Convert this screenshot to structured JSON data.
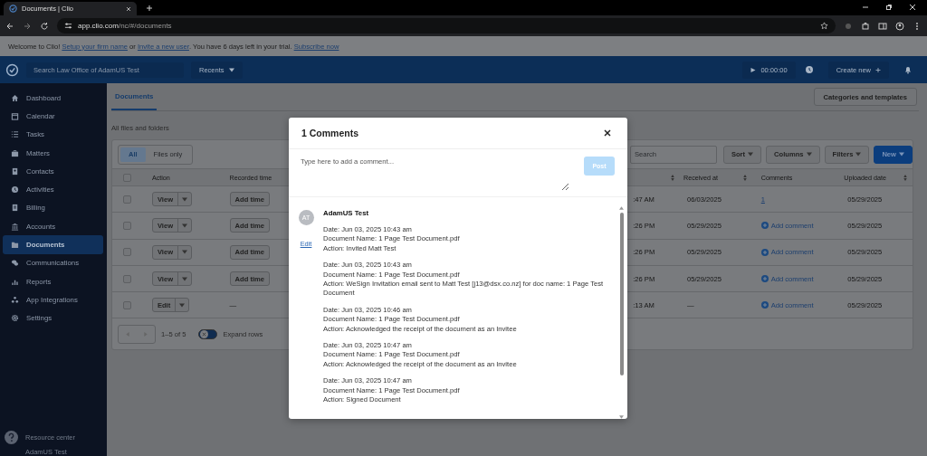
{
  "browser": {
    "tab_title": "Documents | Clio",
    "url_host": "app.clio.com",
    "url_path": "/nc/#/documents"
  },
  "banner": {
    "parts": [
      {
        "text": "Welcome to Clio! ",
        "link": false
      },
      {
        "text": "Setup your firm name",
        "link": true
      },
      {
        "text": " or ",
        "link": false
      },
      {
        "text": "Invite a new user",
        "link": true
      },
      {
        "text": ".  You have 6 days left in your trial. ",
        "link": false
      },
      {
        "text": "Subscribe now",
        "link": true
      }
    ]
  },
  "header": {
    "search_placeholder": "Search Law Office of AdamUS Test",
    "recents": "Recents",
    "timer": "00:00:00",
    "create_new": "Create new"
  },
  "sidebar": {
    "items": [
      {
        "label": "Dashboard",
        "selected": false
      },
      {
        "label": "Calendar",
        "selected": false
      },
      {
        "label": "Tasks",
        "selected": false
      },
      {
        "label": "Matters",
        "selected": false
      },
      {
        "label": "Contacts",
        "selected": false
      },
      {
        "label": "Activities",
        "selected": false
      },
      {
        "label": "Billing",
        "selected": false
      },
      {
        "label": "Accounts",
        "selected": false
      },
      {
        "label": "Documents",
        "selected": true
      },
      {
        "label": "Communications",
        "selected": false
      },
      {
        "label": "Reports",
        "selected": false
      },
      {
        "label": "App Integrations",
        "selected": false
      },
      {
        "label": "Settings",
        "selected": false
      }
    ],
    "resource_center": "Resource center",
    "user": "AdamUS Test"
  },
  "page": {
    "tabs": [
      {
        "label": "Documents",
        "selected": true
      }
    ],
    "categories_button": "Categories and templates",
    "breadcrumb": "All files and folders"
  },
  "filter": {
    "segments": [
      {
        "label": "All",
        "selected": true
      },
      {
        "label": "Files only",
        "selected": false
      }
    ],
    "search_placeholder": "Search",
    "buttons": [
      {
        "label": "Sort",
        "kind": "plain"
      },
      {
        "label": "Columns",
        "kind": "plain"
      },
      {
        "label": "Filters",
        "kind": "plain"
      },
      {
        "label": "New",
        "kind": "primary"
      }
    ]
  },
  "table": {
    "columns": [
      {
        "sortable": false
      },
      {
        "label": "Action",
        "sortable": false
      },
      {
        "label": "Recorded time"
      },
      {
        "sortable": true
      },
      {
        "label": "Received at",
        "sortable": true
      },
      {
        "label": "Comments",
        "sortable": false
      },
      {
        "label": "Uploaded date",
        "sortable": true
      }
    ],
    "rows": [
      {
        "checked": false,
        "action": "View",
        "recorded": "Add time",
        "time": ":47 AM",
        "received": "06/03/2025",
        "comments": {
          "kind": "count",
          "text": "1"
        },
        "uploaded": "05/29/2025"
      },
      {
        "checked": false,
        "action": "View",
        "recorded": "Add time",
        "time": ":26 PM",
        "received": "05/29/2025",
        "comments": {
          "kind": "add",
          "text": "Add comment"
        },
        "uploaded": "05/29/2025"
      },
      {
        "checked": false,
        "action": "View",
        "recorded": "Add time",
        "time": ":26 PM",
        "received": "05/29/2025",
        "comments": {
          "kind": "add",
          "text": "Add comment"
        },
        "uploaded": "05/29/2025"
      },
      {
        "checked": false,
        "action": "View",
        "recorded": "Add time",
        "time": ":26 PM",
        "received": "05/29/2025",
        "comments": {
          "kind": "add",
          "text": "Add comment"
        },
        "uploaded": "05/29/2025"
      },
      {
        "checked": false,
        "action": "Edit",
        "recorded": "—",
        "time": ":13 AM",
        "received": "—",
        "comments": {
          "kind": "add",
          "text": "Add comment"
        },
        "uploaded": "05/29/2025"
      }
    ],
    "range": "1–5 of 5",
    "expand_rows": {
      "label": "Expand rows",
      "on": false
    }
  },
  "modal": {
    "title": "1 Comments",
    "placeholder": "Type here to add a comment...",
    "post": "Post",
    "post_disabled": true,
    "comment": {
      "initials": "AT",
      "author": "AdamUS Test",
      "edit": "Edit",
      "entries": [
        [
          "Date: Jun 03, 2025 10:43 am",
          "Document Name: 1 Page Test Document.pdf",
          "Action: Invited Matt Test"
        ],
        [
          "Date: Jun 03, 2025 10:43 am",
          "Document Name: 1 Page Test Document.pdf",
          "Action: WeSign Invitation email sent to Matt Test [j13@dsx.co.nz] for doc name: 1 Page Test Document"
        ],
        [
          "Date: Jun 03, 2025 10:46 am",
          "Document Name: 1 Page Test Document.pdf",
          "Action: Acknowledged the receipt of the document as an Invitee"
        ],
        [
          "Date: Jun 03, 2025 10:47 am",
          "Document Name: 1 Page Test Document.pdf",
          "Action: Acknowledged the receipt of the document as an Invitee"
        ],
        [
          "Date: Jun 03, 2025 10:47 am",
          "Document Name: 1 Page Test Document.pdf",
          "Action: Signed Document"
        ]
      ]
    }
  }
}
